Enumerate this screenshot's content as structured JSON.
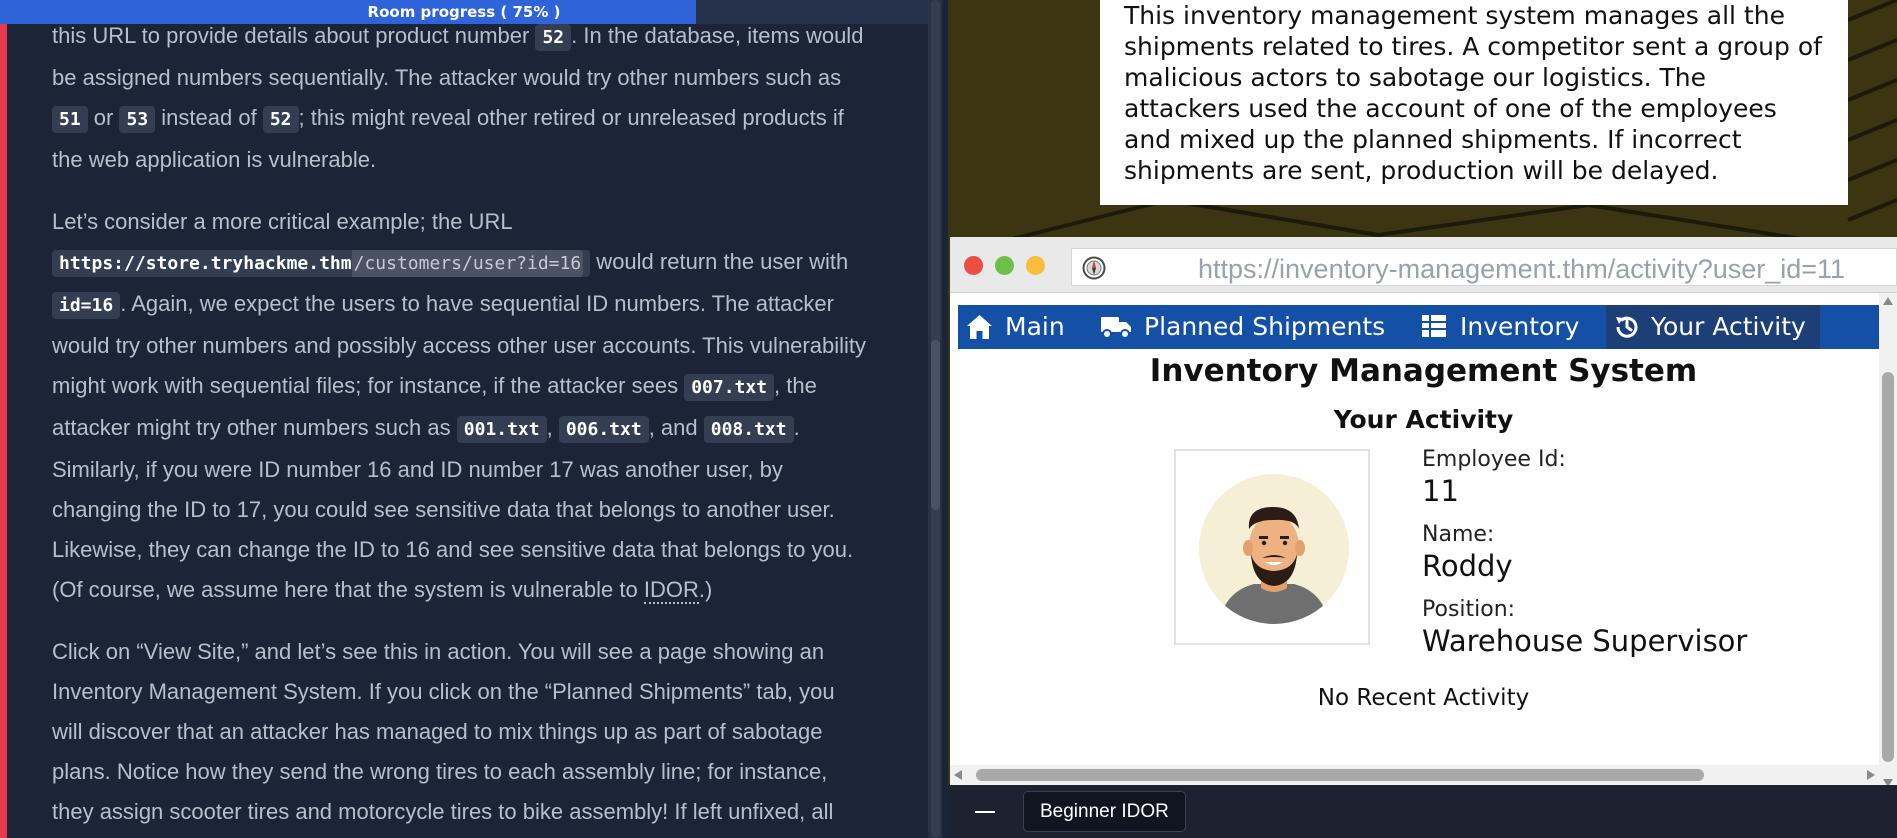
{
  "progress": {
    "label": "Room progress ( 75% )",
    "percent": 75
  },
  "article": {
    "p1": {
      "t1": "this URL to provide details about product number ",
      "c1": "52",
      "t2": ". In the database, items would be assigned numbers sequentially. The attacker would try other numbers such as ",
      "c2": "51",
      "t3": " or ",
      "c3": "53",
      "t4": " instead of ",
      "c4": "52",
      "t5": "; this might reveal other retired or unreleased products if the web application is vulnerable."
    },
    "p2": {
      "t1": "Let’s consider a more critical example; the URL ",
      "url_a": "https://store.tryhackme.thm",
      "url_b": "/customers/user?id=16",
      "t2": " would return the user with ",
      "c1": "id=16",
      "t3": ". Again, we expect the users to have sequential ID numbers. The attacker would try other numbers and possibly access other user accounts. This vulnerability might work with sequential files; for instance, if the attacker sees ",
      "c2": "007.txt",
      "t4": ", the attacker might try other numbers such as ",
      "c3": "001.txt",
      "t5": ", ",
      "c4": "006.txt",
      "t6": ", and ",
      "c5": "008.txt",
      "t7": ". Similarly, if you were ID number 16 and ID number 17 was another user, by changing the ID to 17, you could see sensitive data that belongs to another user. Likewise, they can change the ID to 16 and see sensitive data that belongs to you. (Of course, we assume here that the system is vulnerable to ",
      "abbr": "IDOR",
      "t8": ".)"
    },
    "p3": "Click on “View Site,” and let’s see this in action. You will see a page showing an Inventory Management System. If you click on the “Planned Shipments” tab, you will discover that an attacker has managed to mix things up as part of sabotage plans. Notice how they send the wrong tires to each assembly line; for instance, they assign scooter tires and motorcycle tires to bike assembly! If left unfixed, all"
  },
  "description": "This inventory management system manages all the shipments related to tires. A competitor sent a group of malicious actors to sabotage our logistics. The attackers used the account of one of the employees and mixed up the planned shipments. If incorrect shipments are sent, production will be delayed.",
  "browser": {
    "url": "https://inventory-management.thm/activity?user_id=11"
  },
  "app": {
    "nav": {
      "main": "Main",
      "shipments": "Planned Shipments",
      "inventory": "Inventory",
      "activity": "Your Activity"
    },
    "title": "Inventory Management System",
    "section_title": "Your Activity",
    "employee": {
      "id_label": "Employee Id:",
      "id_value": "11",
      "name_label": "Name:",
      "name_value": "Roddy",
      "position_label": "Position:",
      "position_value": "Warehouse Supervisor"
    },
    "no_activity": "No Recent Activity"
  },
  "taskbar": {
    "tab_label": "Beginner IDOR"
  },
  "colors": {
    "accent_red": "#e53a4c",
    "progress_blue": "#2f63d9",
    "nav_blue": "#1451a6",
    "nav_active": "#1c3f78"
  },
  "icons": {
    "nav_main": "home-icon",
    "nav_shipments": "truck-icon",
    "nav_inventory": "table-icon",
    "nav_activity": "history-icon",
    "site_icon": "compass-icon"
  }
}
